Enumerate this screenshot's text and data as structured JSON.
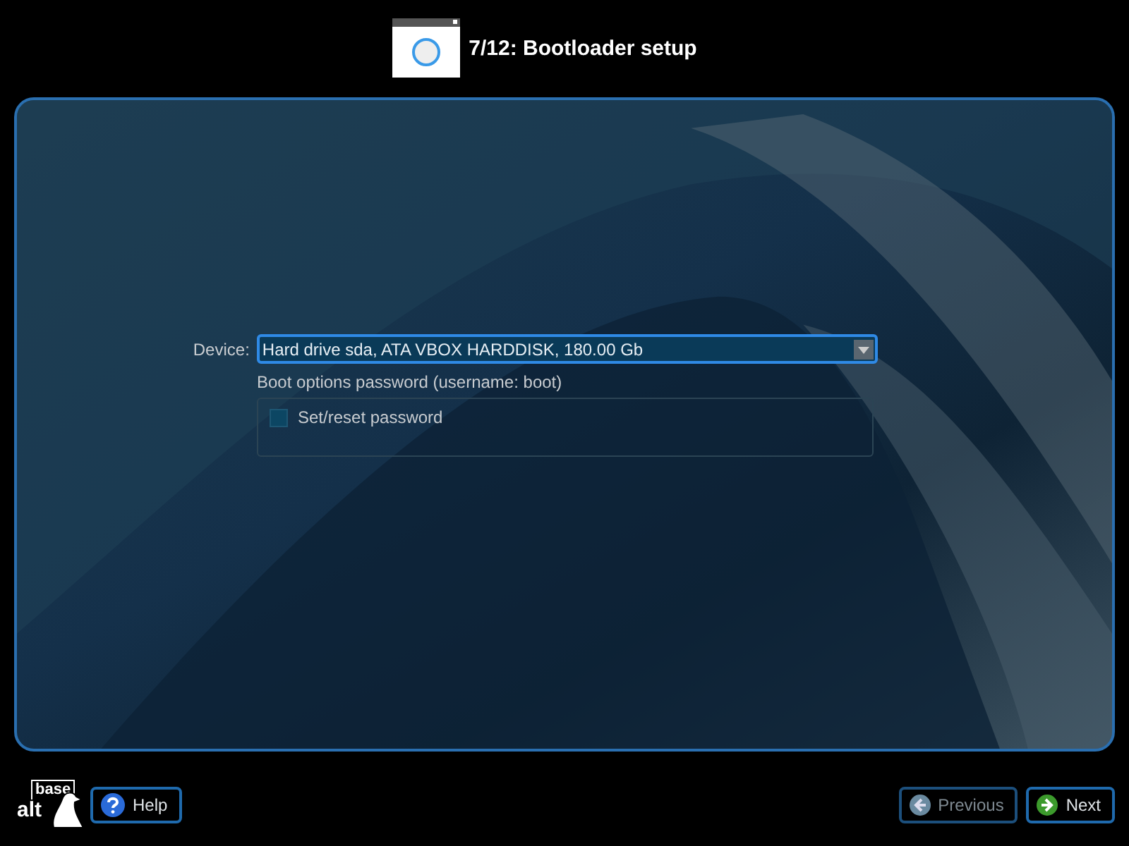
{
  "header": {
    "title": "7/12: Bootloader setup"
  },
  "form": {
    "device_label": "Device:",
    "device_value": "Hard drive sda, ATA VBOX HARDDISK, 180.00 Gb",
    "password_group_title": "Boot options password (username: boot)",
    "password_checkbox": {
      "label": "Set/reset password",
      "checked": false
    }
  },
  "footer": {
    "logo": [
      "base",
      "alt"
    ],
    "buttons": [
      {
        "kind": "help",
        "label": "Help",
        "disabled": false
      },
      {
        "kind": "previous",
        "label": "Previous",
        "disabled": true
      },
      {
        "kind": "next",
        "label": "Next",
        "disabled": false
      }
    ]
  }
}
